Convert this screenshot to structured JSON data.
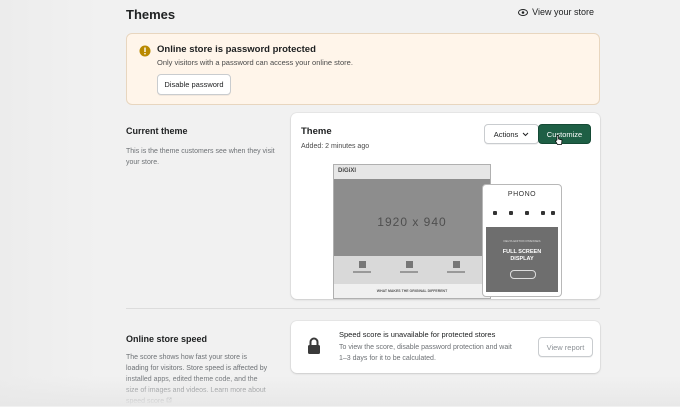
{
  "header": {
    "title": "Themes",
    "view_store_label": "View your store",
    "view_store_icon": "eye-icon"
  },
  "banner": {
    "title": "Online store is password protected",
    "text": "Only visitors with a password can access your online store.",
    "button_label": "Disable password",
    "icon": "info-icon"
  },
  "current_theme": {
    "section_title": "Current theme",
    "section_description": "This is the theme customers see when they visit your store.",
    "theme_name": "Theme",
    "added": "Added: 2 minutes ago",
    "actions_label": "Actions",
    "customize_label": "Customize",
    "preview": {
      "desktop_logo": "DiGiXl",
      "desktop_size_text": "1920 x 940",
      "desktop_footer_text": "WHAT MAKES THE ORIGINAL DIFFERENT",
      "phone_logo": "PHONO",
      "phone_small_text": "DELTA EDITION PRESSES",
      "phone_headline_line1": "FULL SCREEN",
      "phone_headline_line2": "DISPLAY"
    }
  },
  "speed": {
    "section_title": "Online store speed",
    "section_description": "The score shows how fast your store is loading for visitors. Store speed is affected by installed apps, edited theme code, and the size of images and videos. Learn more about speed score",
    "card_title": "Speed score is unavailable for protected stores",
    "card_text": "To view the score, disable password protection and wait 1–3 days for it to be calculated.",
    "view_report_label": "View report",
    "icon": "lock-icon"
  },
  "colors": {
    "primary_button": "#1e5f45",
    "banner_bg": "#fff5ea",
    "page_bg": "#f1f1f1"
  }
}
